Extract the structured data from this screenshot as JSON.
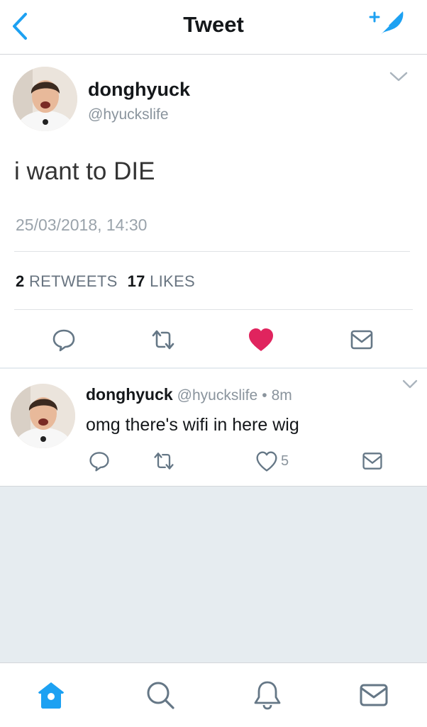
{
  "header": {
    "title": "Tweet",
    "back_icon": "chevron-left-icon",
    "compose_icon": "compose-feather-icon"
  },
  "tweet": {
    "author_name": "donghyuck",
    "author_handle": "@hyuckslife",
    "text": "i want to DIE",
    "timestamp": "25/03/2018, 14:30",
    "retweets_count": "2",
    "retweets_label": "RETWEETS",
    "likes_count": "17",
    "likes_label": "LIKES",
    "liked": true
  },
  "reply": {
    "author_name": "donghyuck",
    "author_handle": "@hyuckslife",
    "separator": "•",
    "age": "8m",
    "text": "omg there's wifi in here wig",
    "likes_count": "5"
  },
  "tabbar": {
    "items": [
      "home-icon",
      "search-icon",
      "notifications-icon",
      "messages-icon"
    ]
  },
  "colors": {
    "accent": "#1da1f2",
    "like": "#e0245e",
    "muted": "#8a949d",
    "divider": "#e6ecf0"
  }
}
